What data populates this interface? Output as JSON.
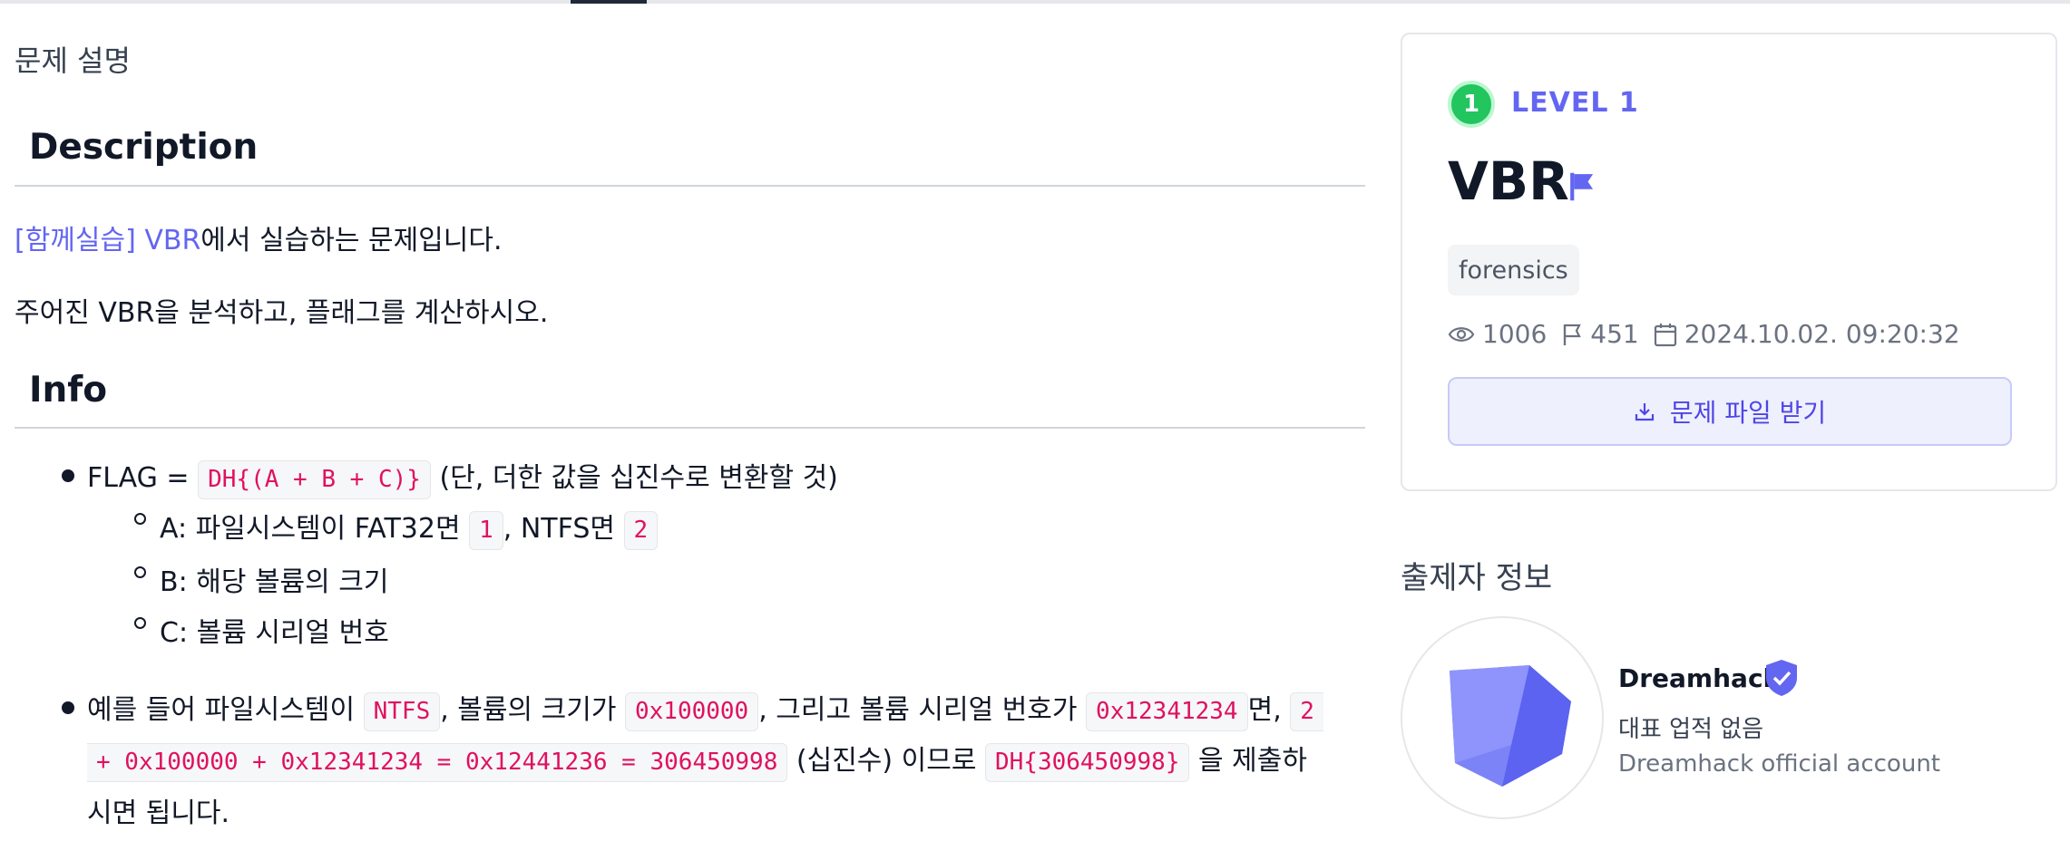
{
  "tabs": {
    "active_tab_indicator": "active"
  },
  "content": {
    "section_title": "문제 설명",
    "description_heading": "Description",
    "intro_link": "[함께실습] VBR",
    "intro_rest": "에서 실습하는 문제입니다.",
    "instruction": "주어진 VBR을 분석하고, 플래그를 계산하시오.",
    "info_heading": "Info",
    "flag_prefix": "FLAG = ",
    "flag_code": "DH{(A + B + C)}",
    "flag_suffix": " (단, 더한 값을 십진수로 변환할 것)",
    "a_prefix": "A: 파일시스템이 FAT32면 ",
    "a_code1": "1",
    "a_mid": ", NTFS면 ",
    "a_code2": "2",
    "b_text": "B: 해당 볼륨의 크기",
    "c_text": "C: 볼륨 시리얼 번호",
    "ex_prefix": "예를 들어 파일시스템이 ",
    "ex_code_fs": "NTFS",
    "ex_mid1": ", 볼륨의 크기가 ",
    "ex_code_size": "0x100000",
    "ex_mid2": ", 그리고 볼륨 시리얼 번호가 ",
    "ex_code_serial": "0x12341234",
    "ex_mid3": "면, ",
    "ex_code_calc_a": "2",
    "ex_code_calc_b": "+ 0x100000 + 0x12341234 = 0x12441236 = 306450998",
    "ex_mid4": " (십진수) 이므로 ",
    "ex_code_flag": "DH{306450998}",
    "ex_suffix": " 을 제출하",
    "ex_end": "시면 됩니다."
  },
  "challenge": {
    "level_number": "1",
    "level_label": "LEVEL 1",
    "title": "VBR",
    "tag": "forensics",
    "views": "1006",
    "solves": "451",
    "date": "2024.10.02. 09:20:32",
    "download_label": "문제 파일 받기",
    "colors": {
      "accent": "#6366f1",
      "level_green": "#22c55e"
    }
  },
  "author": {
    "section_title": "출제자 정보",
    "name": "Dreamhack",
    "badge_text": "대표 업적 없음",
    "description": "Dreamhack official account"
  }
}
